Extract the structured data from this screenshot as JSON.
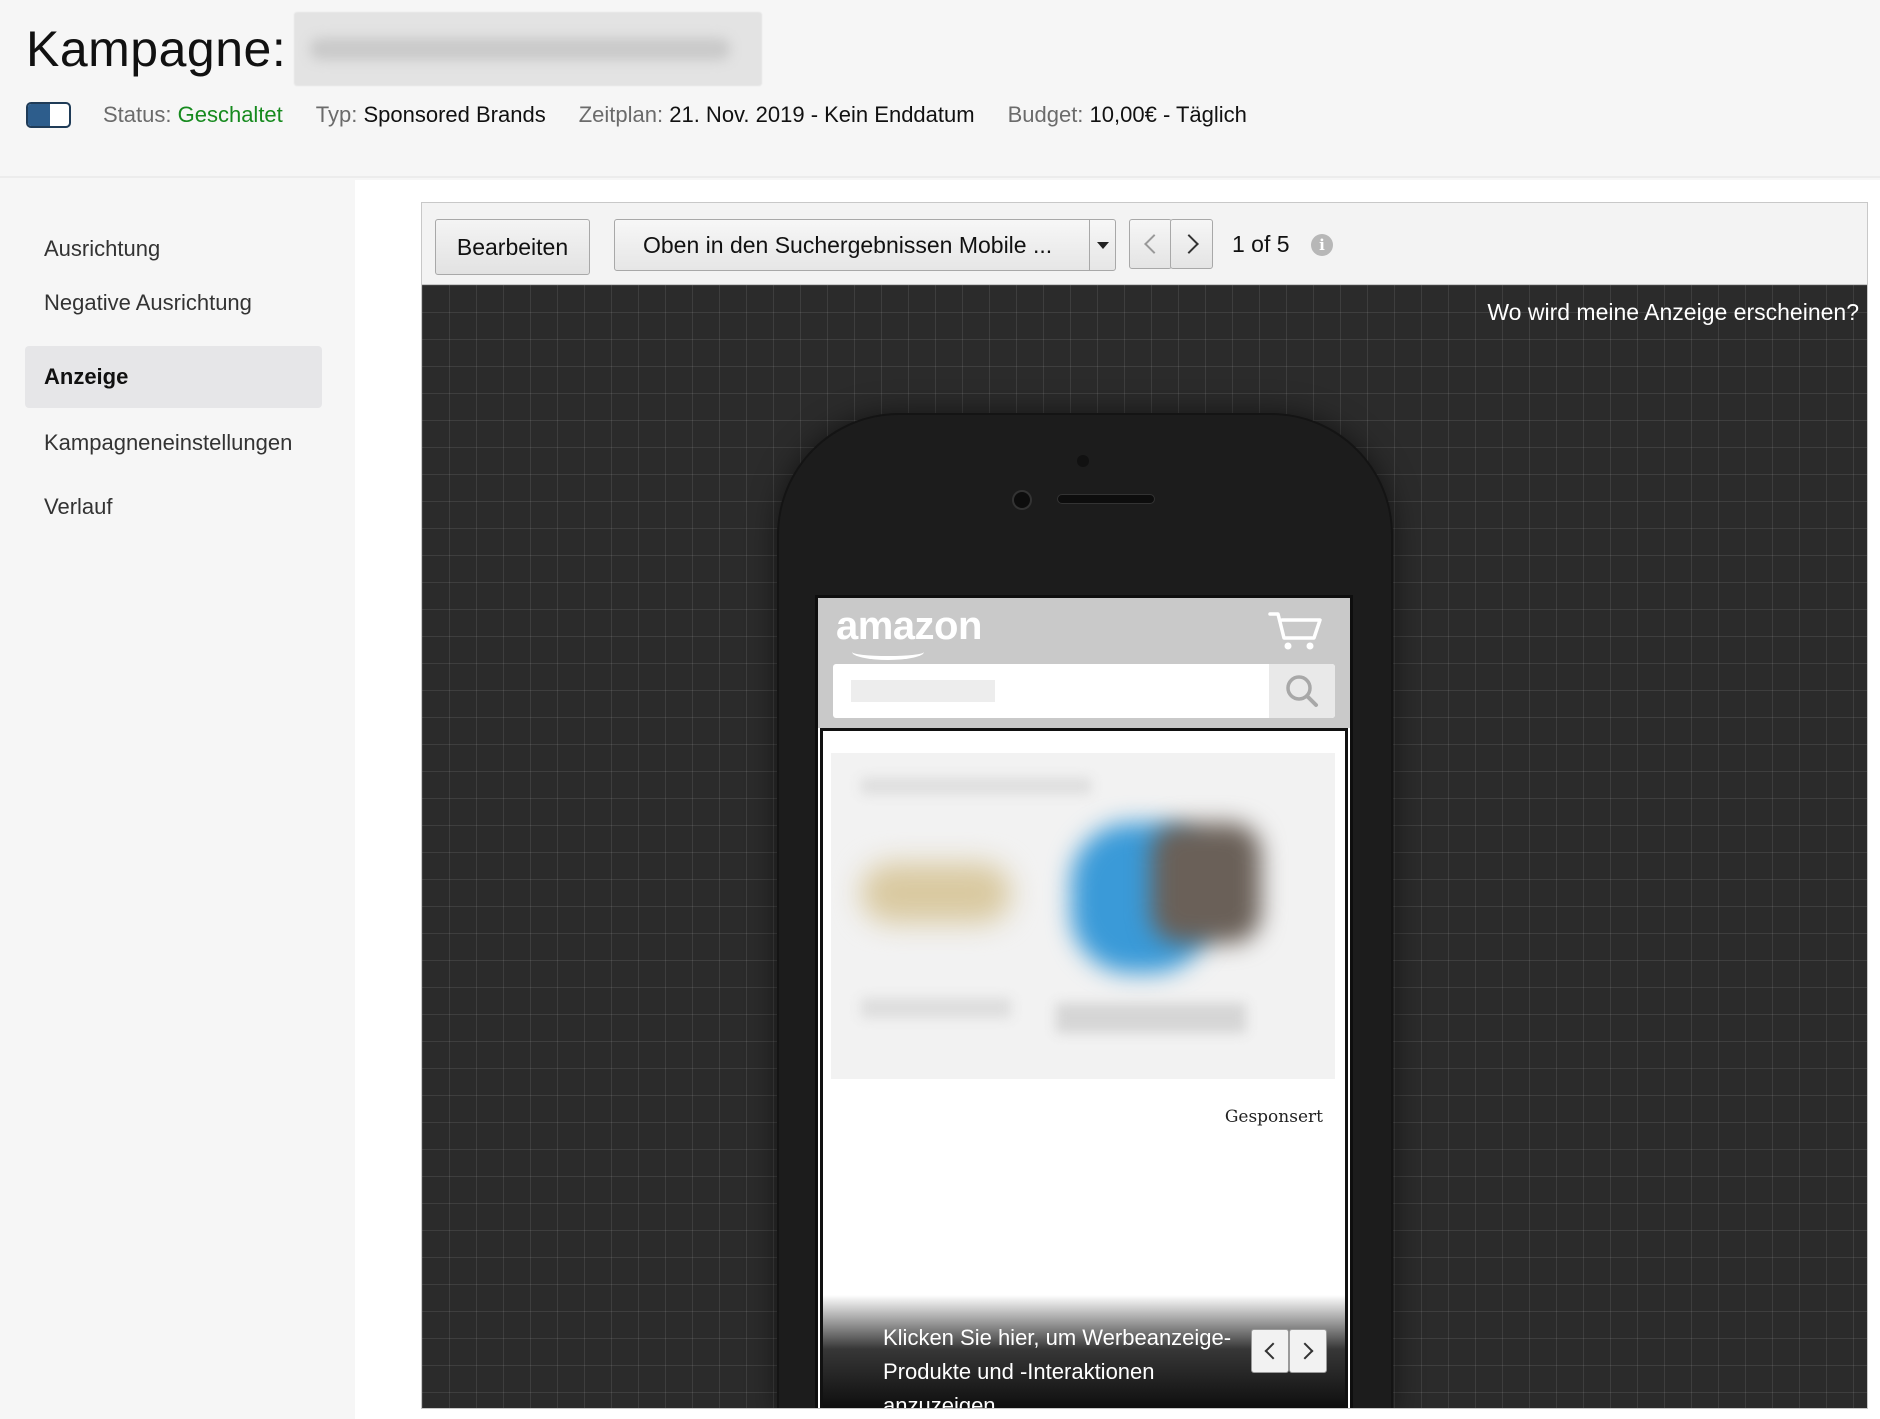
{
  "header": {
    "title_label": "Kampagne:",
    "status_key": "Status:",
    "status_value": "Geschaltet",
    "type_key": "Typ:",
    "type_value": "Sponsored Brands",
    "schedule_key": "Zeitplan:",
    "schedule_value": "21. Nov. 2019 - Kein Enddatum",
    "budget_key": "Budget:",
    "budget_value": "10,00€ - Täglich",
    "toggle_state": "on"
  },
  "sidebar": {
    "items": [
      {
        "label": "Ausrichtung",
        "active": false
      },
      {
        "label": "Negative Ausrichtung",
        "active": false
      },
      {
        "label": "Anzeige",
        "active": true
      },
      {
        "label": "Kampagneneinstellungen",
        "active": false
      },
      {
        "label": "Verlauf",
        "active": false
      }
    ]
  },
  "toolbar": {
    "edit_label": "Bearbeiten",
    "placement_selected": "Oben in den Suchergebnissen Mobile ...",
    "pager_text": "1 of 5",
    "info_icon": "i"
  },
  "preview": {
    "where_link": "Wo wird meine Anzeige erscheinen?",
    "logo_text": "amazon",
    "sponsored_label": "Gesponsert",
    "interaction_text": "Klicken Sie hier, um Werbeanzeige-Produkte und -Interaktionen anzuzeigen"
  },
  "colors": {
    "status_green": "#168a1e",
    "toggle_blue": "#2d5d8c",
    "stage_bg": "#2b2b2b"
  }
}
